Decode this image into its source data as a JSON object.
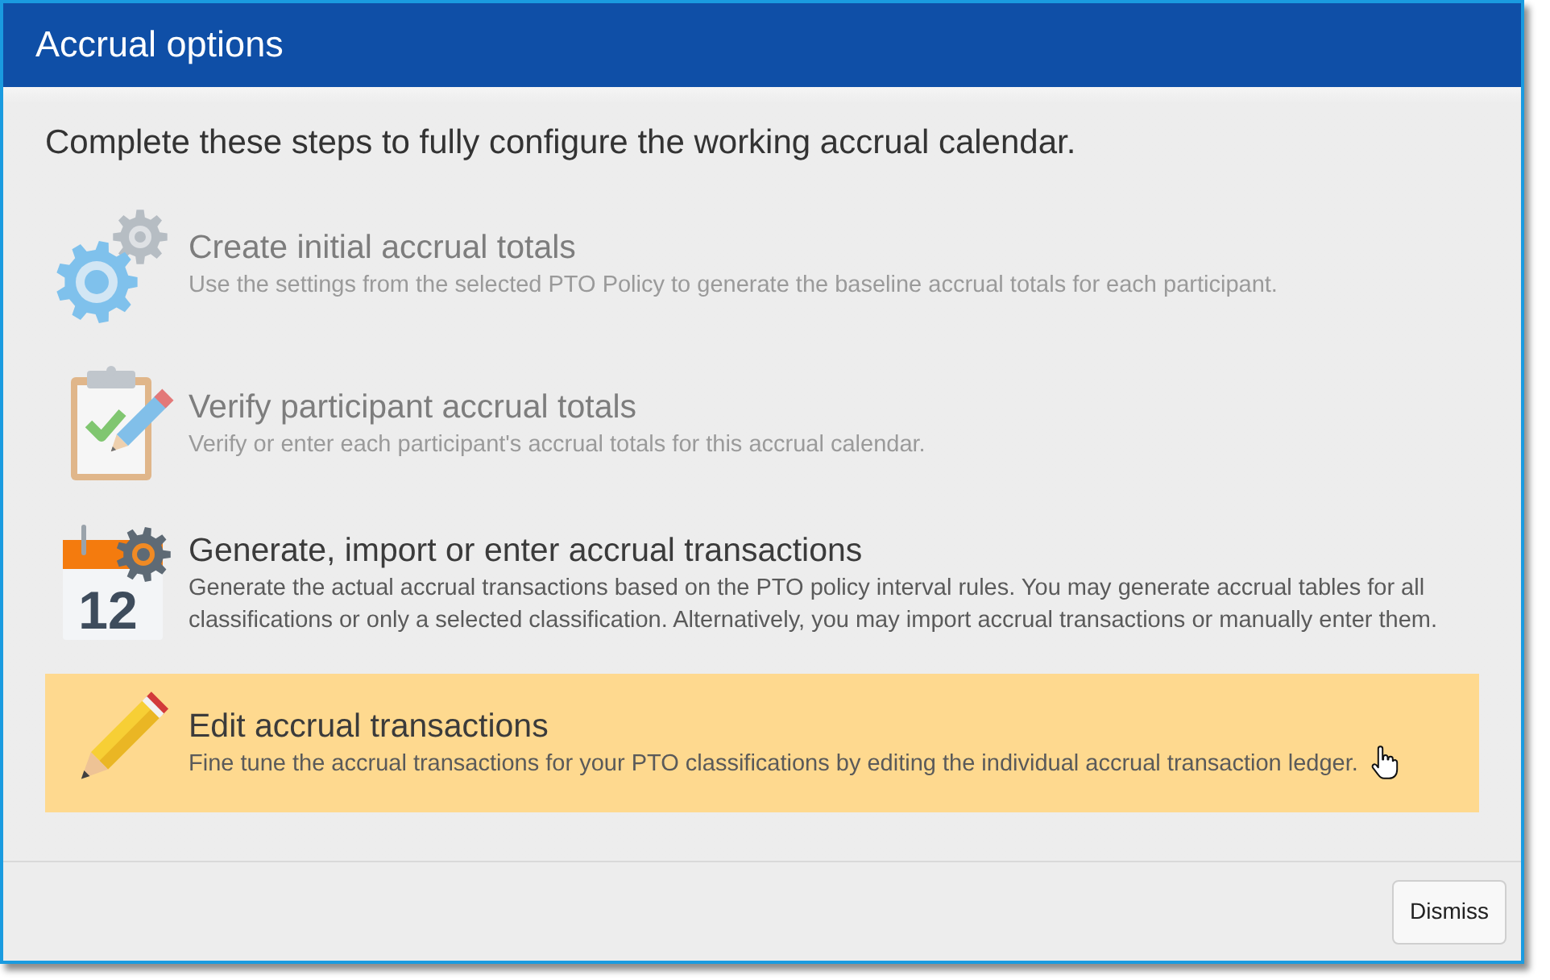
{
  "window": {
    "title": "Accrual options"
  },
  "intro": "Complete these steps to fully configure the working accrual calendar.",
  "steps": [
    {
      "title": "Create initial accrual totals",
      "description": "Use the settings from the selected PTO Policy to generate the baseline accrual totals for each participant.",
      "disabled": true,
      "selected": false
    },
    {
      "title": "Verify participant accrual totals",
      "description": "Verify or enter each participant's accrual totals for this accrual calendar.",
      "disabled": true,
      "selected": false
    },
    {
      "title": "Generate, import or enter accrual transactions",
      "description": "Generate the actual accrual transactions based on the PTO policy interval rules. You may generate accrual tables for all classifications or only a selected classification. Alternatively, you may import accrual transactions or manually enter them.",
      "calendar_day": "12",
      "disabled": false,
      "selected": false
    },
    {
      "title": "Edit accrual transactions",
      "description": "Fine tune the accrual transactions for your PTO classifications by editing the individual accrual transaction ledger.",
      "disabled": false,
      "selected": true
    }
  ],
  "buttons": [
    {
      "label": "Dismiss"
    }
  ]
}
